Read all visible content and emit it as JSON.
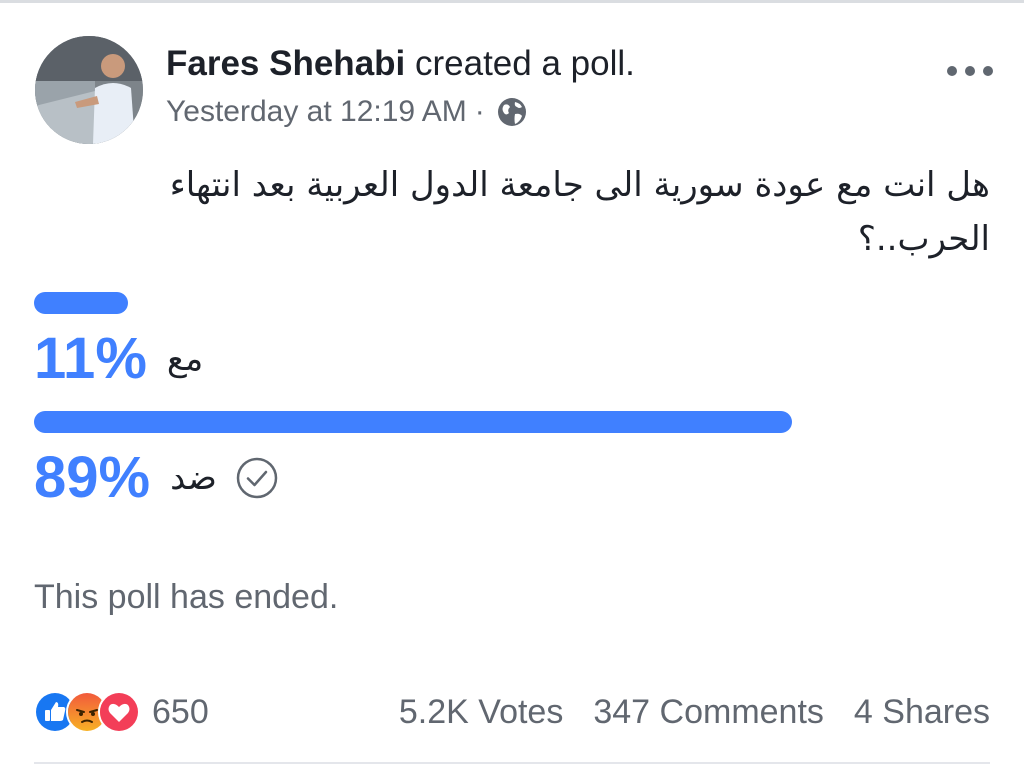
{
  "post": {
    "author": "Fares Shehabi",
    "action": "created a poll.",
    "timestamp": "Yesterday at 12:19 AM",
    "separator": "·",
    "audience_icon": "globe-icon",
    "menu_icon": "more-horizontal-icon",
    "question": "هل انت مع عودة سورية الى جامعة الدول العربية بعد انتهاء الحرب..؟"
  },
  "poll": {
    "accent_color": "#4080ff",
    "options": [
      {
        "label": "مع",
        "percent_text": "11%",
        "share": 0.11,
        "selected": false
      },
      {
        "label": "ضد",
        "percent_text": "89%",
        "share": 0.89,
        "selected": true
      }
    ],
    "status": "This poll has ended."
  },
  "footer": {
    "reaction_icons": [
      "like-icon",
      "angry-icon",
      "love-icon"
    ],
    "reaction_count": "650",
    "votes": "5.2K Votes",
    "comments": "347 Comments",
    "shares": "4 Shares"
  }
}
